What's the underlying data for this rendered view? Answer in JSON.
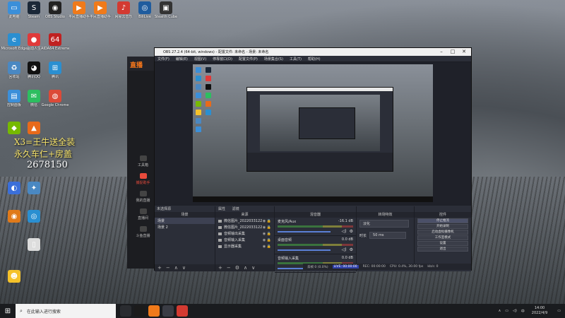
{
  "desktop": {
    "icons": [
      {
        "label": "此电脑",
        "color": "#3b8fd9",
        "glyph": "▭"
      },
      {
        "label": "Steam",
        "color": "#1b2838",
        "glyph": "S"
      },
      {
        "label": "OBS Studio",
        "color": "#222",
        "glyph": "◉"
      },
      {
        "label": "平民直播助手",
        "color": "#f07a1a",
        "glyph": "▶"
      },
      {
        "label": "平民直播助手",
        "color": "#f07a1a",
        "glyph": "▶"
      },
      {
        "label": "网易云音乐",
        "color": "#d33a31",
        "glyph": "♪"
      },
      {
        "label": "BiliLive",
        "color": "#1f5c9e",
        "glyph": "◎"
      },
      {
        "label": "Stealth Cube",
        "color": "#333",
        "glyph": "▣"
      },
      {
        "label": "Microsoft Edge",
        "color": "#2a8fd1",
        "glyph": "e"
      },
      {
        "label": "驱动人生",
        "color": "#e03a3a",
        "glyph": "●"
      },
      {
        "label": "AIDA64 Extreme",
        "color": "#c02121",
        "glyph": "64"
      },
      {
        "label": "回收站",
        "color": "#4a88c2",
        "glyph": "♻"
      },
      {
        "label": "腾讯QQ",
        "color": "#111",
        "glyph": "◕"
      },
      {
        "label": "腾讯",
        "color": "#2a8fd1",
        "glyph": "⊞"
      },
      {
        "label": "控制面板",
        "color": "#3b8fd9",
        "glyph": "▤"
      },
      {
        "label": "微信",
        "color": "#2dbe60",
        "glyph": "✉"
      },
      {
        "label": "Google Chrome",
        "color": "#dc4a38",
        "glyph": "◍"
      },
      {
        "label": "",
        "color": "#76b900",
        "glyph": "◆"
      },
      {
        "label": "",
        "color": "#e86a1a",
        "glyph": "▲"
      },
      {
        "label": "",
        "color": "#3b6fd9",
        "glyph": "◐"
      },
      {
        "label": "",
        "color": "#4a88c2",
        "glyph": "✦"
      },
      {
        "label": "",
        "color": "#e07a1a",
        "glyph": "◉"
      },
      {
        "label": "",
        "color": "#2a8fd1",
        "glyph": "◎"
      },
      {
        "label": "",
        "color": "#ddd",
        "glyph": "▯"
      },
      {
        "label": "",
        "color": "#f5c22a",
        "glyph": "☻"
      }
    ],
    "overlay_line1": "X3=王牛送全装",
    "overlay_line2": "永久车仁+房盖",
    "overlay_number": "2678150"
  },
  "live_app": {
    "logo": "直播",
    "nav": [
      {
        "label": "工具箱",
        "active": false
      },
      {
        "label": "捕捉助手",
        "active": true
      },
      {
        "label": "我的直播",
        "active": false
      },
      {
        "label": "直播间",
        "active": false
      },
      {
        "label": "斗鱼直播",
        "active": false
      }
    ]
  },
  "obs": {
    "title": "OBS 27.2.4 (64-bit, windows) - 配置文件: 未命名 - 场景: 未命名",
    "menu": [
      "文件(F)",
      "编辑(E)",
      "视图(V)",
      "停靠窗口(D)",
      "配置文件(P)",
      "场景集合(S)",
      "工具(T)",
      "帮助(H)"
    ],
    "preview_bar": {
      "label": "未选择源",
      "props": "属性",
      "filters": "滤镜"
    },
    "scenes": {
      "header": "场景",
      "items": [
        "场景",
        "场景 2"
      ]
    },
    "sources": {
      "header": "来源",
      "items": [
        "微信图片_2022033122",
        "微信图片_2022033122",
        "音频输出采集",
        "音频输入采集",
        "显示器采集"
      ]
    },
    "mixer": {
      "header": "混音器",
      "channels": [
        {
          "name": "麦克风/Aux",
          "db": "-16.1 dB"
        },
        {
          "name": "桌面音频",
          "db": "0.0 dB"
        },
        {
          "name": "音频输入采集",
          "db": "0.0 dB"
        }
      ]
    },
    "transitions": {
      "header": "转场特效",
      "type": "淡化",
      "duration_label": "时长",
      "duration": "50 ms"
    },
    "controls": {
      "header": "控件",
      "buttons": [
        "停止推流",
        "开始录制",
        "启动虚拟摄像机",
        "工作室模式",
        "设置",
        "退出"
      ]
    },
    "status": {
      "live": "LIVE: 00:00:00",
      "rec": "REC: 00:00:00",
      "cpu": "CPU: 0.4%, 30.00 fps",
      "dropped": "丢帧 0 (0.0%)",
      "kbps": "kb/s: 0"
    }
  },
  "taskbar": {
    "search_placeholder": "在此输入进行搜索",
    "time": "14:00",
    "date": "2022/4/9",
    "ime": "中"
  }
}
